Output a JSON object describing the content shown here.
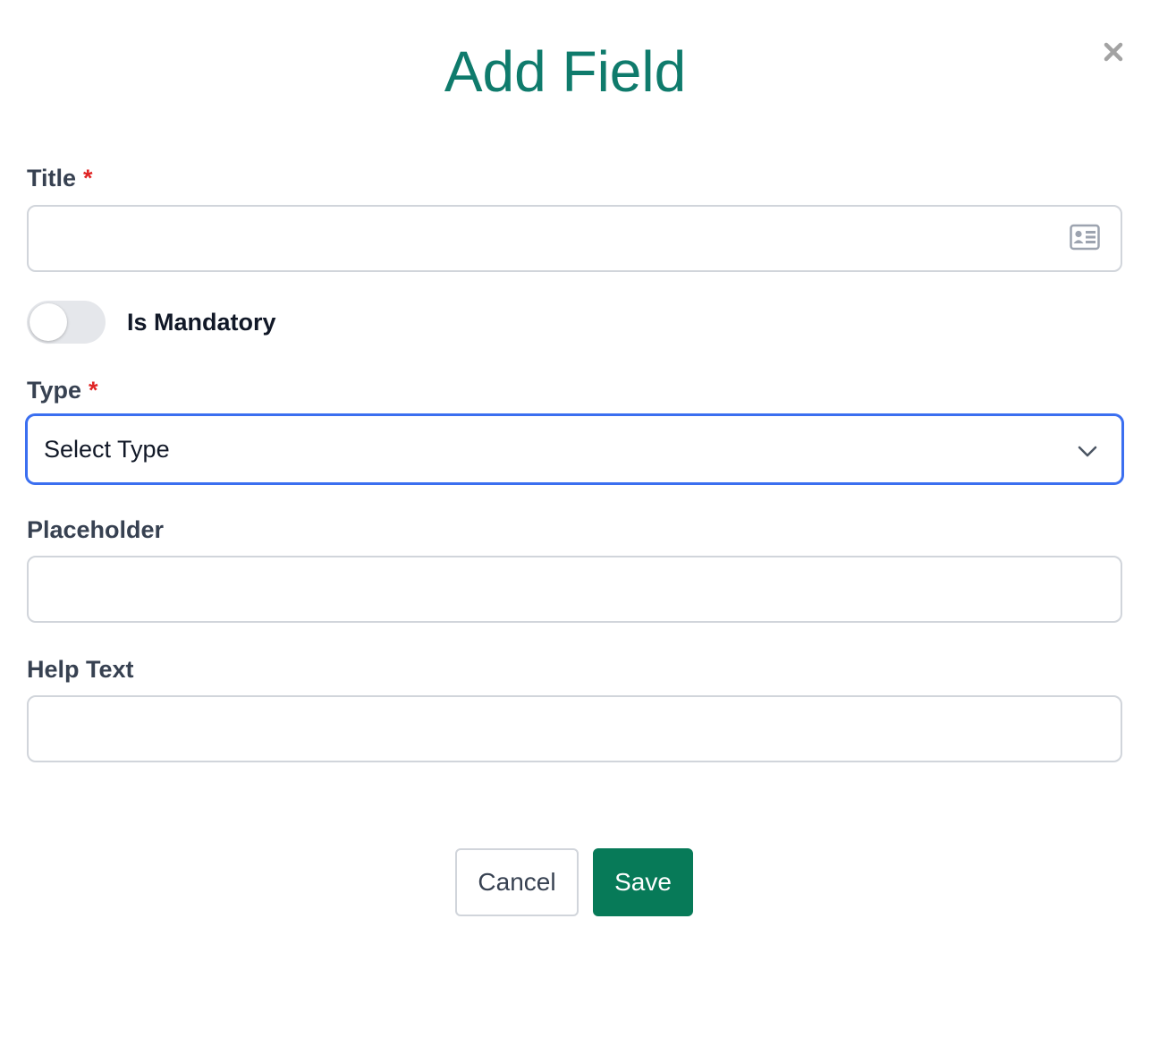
{
  "dialog": {
    "title": "Add Field",
    "close_icon": "close-icon"
  },
  "form": {
    "title_field": {
      "label": "Title",
      "required_marker": "*",
      "value": "",
      "placeholder": "",
      "icon": "contact-card-icon"
    },
    "mandatory_toggle": {
      "label": "Is Mandatory",
      "checked": false
    },
    "type_field": {
      "label": "Type",
      "required_marker": "*",
      "selected": "Select Type",
      "icon": "chevron-down-icon"
    },
    "placeholder_field": {
      "label": "Placeholder",
      "value": "",
      "placeholder": ""
    },
    "help_text_field": {
      "label": "Help Text",
      "value": "",
      "placeholder": ""
    }
  },
  "actions": {
    "cancel_label": "Cancel",
    "save_label": "Save"
  },
  "colors": {
    "title": "#0f7b6c",
    "required": "#e02424",
    "focus_border": "#3b6ff0",
    "save_button": "#077a58",
    "input_border": "#d1d5db"
  }
}
